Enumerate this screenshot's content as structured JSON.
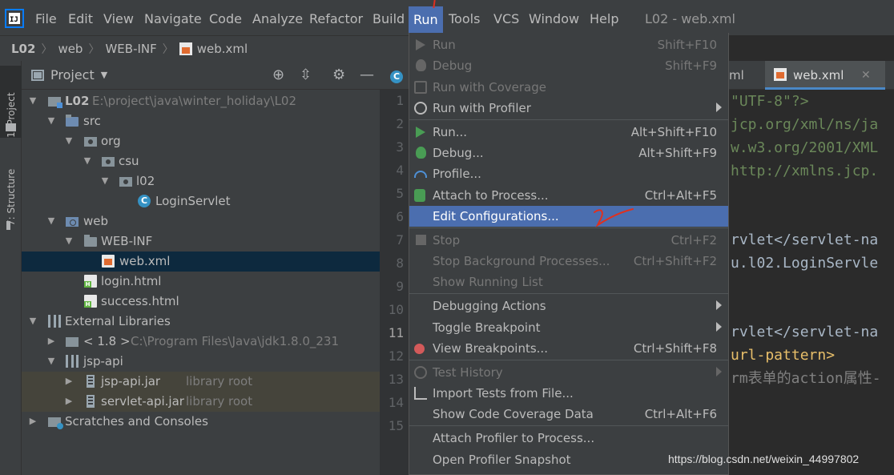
{
  "menubar": {
    "items": [
      "File",
      "Edit",
      "View",
      "Navigate",
      "Code",
      "Analyze",
      "Refactor",
      "Build",
      "Run",
      "Tools",
      "VCS",
      "Window",
      "Help"
    ],
    "active": "Run",
    "title": "L02 - web.xml"
  },
  "breadcrumb": [
    "L02",
    "web",
    "WEB-INF",
    "web.xml"
  ],
  "left_strip": {
    "project_tab": "1: Project",
    "structure_tab": "7: Structure"
  },
  "project_panel": {
    "title": "Project",
    "tree": [
      {
        "label": "L02",
        "sub": "E:\\project\\java\\winter_holiday\\L02"
      },
      {
        "label": "src"
      },
      {
        "label": "org"
      },
      {
        "label": "csu"
      },
      {
        "label": "l02"
      },
      {
        "label": "LoginServlet"
      },
      {
        "label": "web"
      },
      {
        "label": "WEB-INF"
      },
      {
        "label": "web.xml"
      },
      {
        "label": "login.html"
      },
      {
        "label": "success.html"
      },
      {
        "label": "External Libraries"
      },
      {
        "label": "< 1.8 >",
        "sub": "C:\\Program Files\\Java\\jdk1.8.0_231"
      },
      {
        "label": "jsp-api"
      },
      {
        "label": "jsp-api.jar",
        "sub": "library root"
      },
      {
        "label": "servlet-api.jar",
        "sub": "library root"
      },
      {
        "label": "Scratches and Consoles"
      }
    ]
  },
  "gutter_lines": [
    "1",
    "2",
    "3",
    "4",
    "5",
    "6",
    "7",
    "8",
    "9",
    "10",
    "11",
    "12",
    "13",
    "14",
    "15"
  ],
  "run_menu": [
    {
      "label": "Run",
      "shortcut": "Shift+F10",
      "disabled": true
    },
    {
      "label": "Debug",
      "shortcut": "Shift+F9",
      "disabled": true
    },
    {
      "label": "Run with Coverage",
      "shortcut": "",
      "disabled": true
    },
    {
      "label": "Run with Profiler",
      "shortcut": "",
      "disabled": false
    },
    {
      "label": "Run...",
      "shortcut": "Alt+Shift+F10",
      "disabled": false
    },
    {
      "label": "Debug...",
      "shortcut": "Alt+Shift+F9",
      "disabled": false
    },
    {
      "label": "Profile...",
      "shortcut": "",
      "disabled": false
    },
    {
      "label": "Attach to Process...",
      "shortcut": "Ctrl+Alt+F5",
      "disabled": false
    },
    {
      "label": "Edit Configurations...",
      "shortcut": "",
      "disabled": false,
      "highlighted": true
    },
    {
      "label": "Stop",
      "shortcut": "Ctrl+F2",
      "disabled": true
    },
    {
      "label": "Stop Background Processes...",
      "shortcut": "Ctrl+Shift+F2",
      "disabled": true
    },
    {
      "label": "Show Running List",
      "shortcut": "",
      "disabled": true
    },
    {
      "label": "Debugging Actions",
      "shortcut": "",
      "disabled": false
    },
    {
      "label": "Toggle Breakpoint",
      "shortcut": "",
      "disabled": false
    },
    {
      "label": "View Breakpoints...",
      "shortcut": "Ctrl+Shift+F8",
      "disabled": false
    },
    {
      "label": "Test History",
      "shortcut": "",
      "disabled": true
    },
    {
      "label": "Import Tests from File...",
      "shortcut": "",
      "disabled": false
    },
    {
      "label": "Show Code Coverage Data",
      "shortcut": "Ctrl+Alt+F6",
      "disabled": false
    },
    {
      "label": "Attach Profiler to Process...",
      "shortcut": "",
      "disabled": false
    },
    {
      "label": "Open Profiler Snapshot",
      "shortcut": "",
      "disabled": false
    }
  ],
  "editor": {
    "prev_tab": "ml",
    "active_tab": "web.xml",
    "code_lines": [
      "\"UTF-8\"?>",
      "jcp.org/xml/ns/ja",
      "w.w3.org/2001/XML",
      "http://xmlns.jcp.",
      "rvlet</servlet-na",
      "u.l02.LoginServle",
      "rvlet</servlet-na",
      "url-pattern>",
      "rm表单的action属性-"
    ]
  },
  "watermark": "https://blog.csdn.net/weixin_44997802",
  "colors": {
    "menu_highlight": "#4b6eaf",
    "panel_bg": "#3c3f41",
    "editor_bg": "#2b2b2b",
    "selection": "#0d293e",
    "annotation_red": "#e0301e"
  }
}
